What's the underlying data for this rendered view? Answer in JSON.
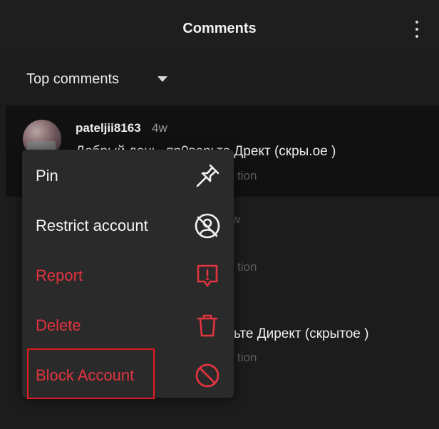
{
  "header": {
    "title": "Comments",
    "menu_icon": "more-vertical-icon"
  },
  "sort": {
    "label": "Top comments",
    "icon": "caret-down-icon"
  },
  "comments": [
    {
      "username": "pateljii8163",
      "time": "4w",
      "text": "Добрый день, пр0верьте Дрект (скры.ое )",
      "action": "tion"
    },
    {
      "time_partial": "w",
      "action": "tion"
    },
    {
      "text_partial": "ьте Директ (скрытое )",
      "action": "tion"
    }
  ],
  "context_menu": {
    "items": [
      {
        "label": "Pin",
        "icon": "pin-icon",
        "color": "#f3f3f3"
      },
      {
        "label": "Restrict account",
        "icon": "restrict-account-icon",
        "color": "#f3f3f3"
      },
      {
        "label": "Report",
        "icon": "report-icon",
        "color": "#e0343f"
      },
      {
        "label": "Delete",
        "icon": "trash-icon",
        "color": "#e0343f"
      },
      {
        "label": "Block Account",
        "icon": "block-icon",
        "color": "#e0343f"
      }
    ]
  },
  "colors": {
    "background": "#1c1c1c",
    "menu": "#2a2a2a",
    "danger": "#e0343f",
    "highlight": "#e11a22"
  }
}
